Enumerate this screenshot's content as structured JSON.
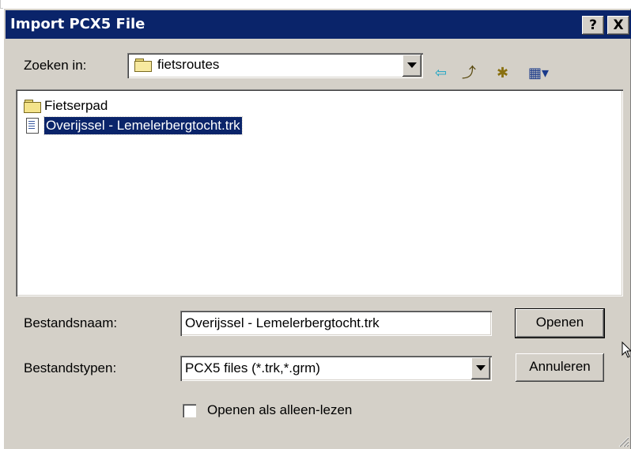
{
  "window": {
    "title": "Import PCX5 File",
    "help_label": "?",
    "close_label": "X"
  },
  "look_in": {
    "label": "Zoeken in:",
    "value": "fietsroutes"
  },
  "toolbar": {
    "back_glyph": "⇦",
    "up_glyph": "⤴",
    "new_folder_glyph": "✱",
    "view_glyph": "▦▾"
  },
  "files": [
    {
      "name": "Fietserpad",
      "icon": "folder-icon",
      "selected": false
    },
    {
      "name": "Overijssel - Lemelerbergtocht.trk",
      "icon": "file-icon",
      "selected": true
    }
  ],
  "filename": {
    "label": "Bestandsnaam:",
    "value": "Overijssel - Lemelerbergtocht.trk"
  },
  "filetype": {
    "label": "Bestandstypen:",
    "value": "PCX5 files (*.trk,*.grm)"
  },
  "buttons": {
    "open": "Openen",
    "cancel": "Annuleren"
  },
  "readonly": {
    "label": "Openen als alleen-lezen",
    "checked": false
  },
  "colors": {
    "titlebar": "#0a246a",
    "face": "#d4d0c8",
    "selection": "#0a246a"
  }
}
